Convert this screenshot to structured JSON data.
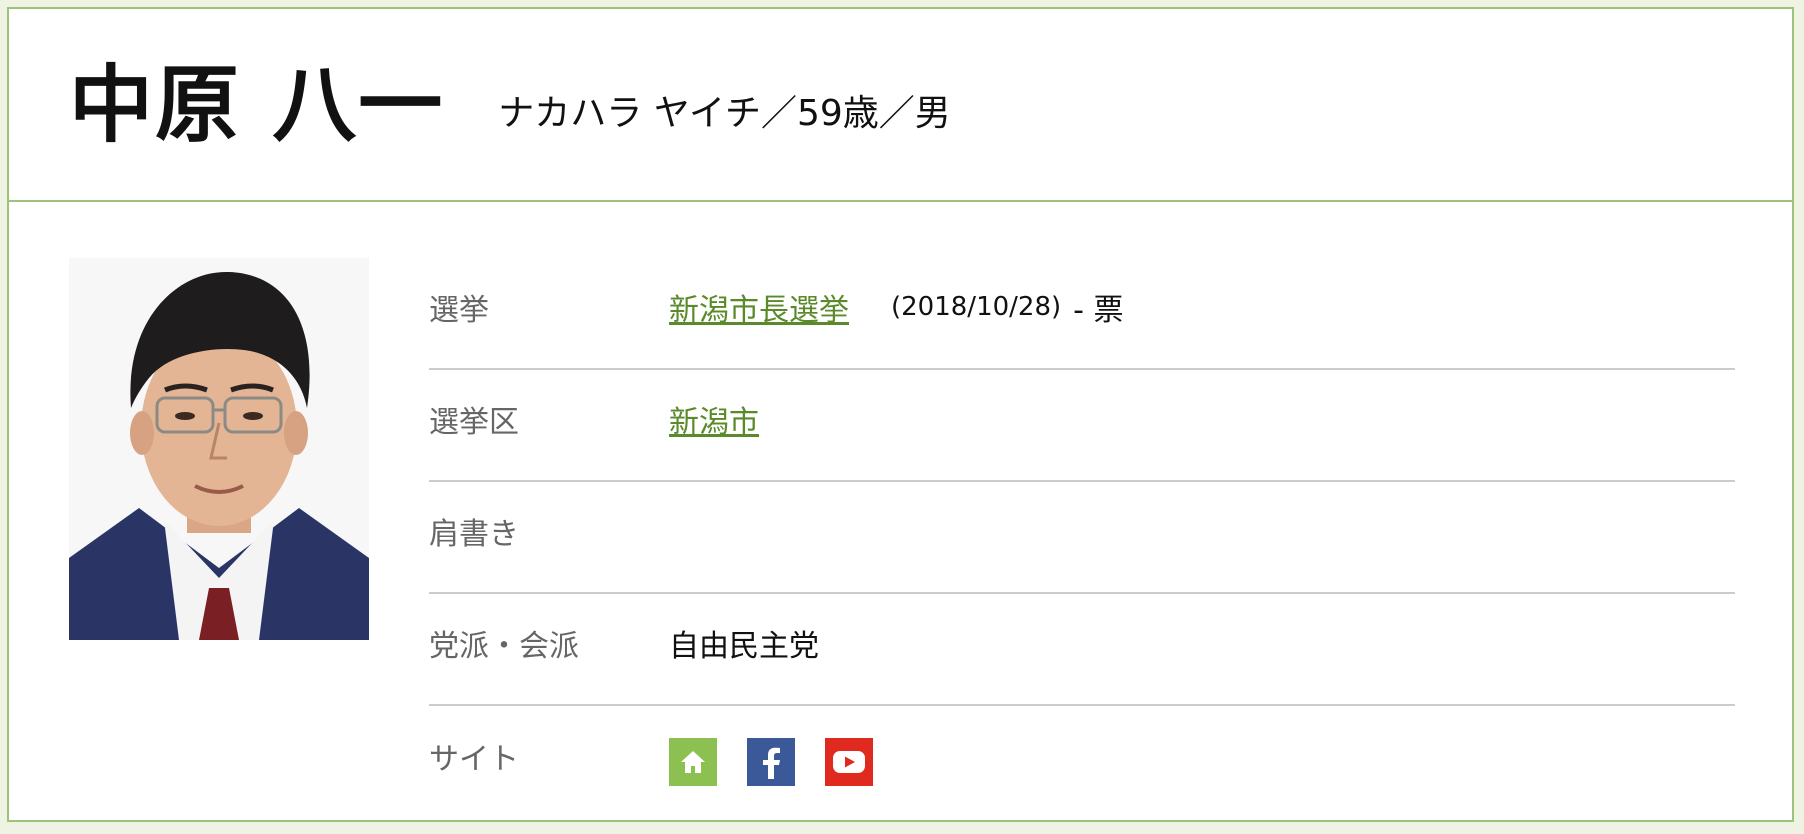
{
  "candidate": {
    "name": "中原 八一",
    "kana_line": "ナカハラ ヤイチ／59歳／男"
  },
  "rows": [
    {
      "label": "選挙",
      "link": "新潟市長選挙",
      "date": "(2018/10/28)",
      "votes": "- 票"
    },
    {
      "label": "選挙区",
      "link": "新潟市"
    },
    {
      "label": "肩書き",
      "value": ""
    },
    {
      "label": "党派・会派",
      "value": "自由民主党"
    },
    {
      "label": "サイト"
    }
  ],
  "site_icons": [
    {
      "icon": "home-icon",
      "color": "#8cc152"
    },
    {
      "icon": "facebook-icon",
      "color": "#3b5998"
    },
    {
      "icon": "youtube-icon",
      "color": "#e02a20"
    }
  ],
  "colors": {
    "border_green": "#9fc279",
    "link_green": "#5b8a2a",
    "label_gray": "#666666"
  }
}
